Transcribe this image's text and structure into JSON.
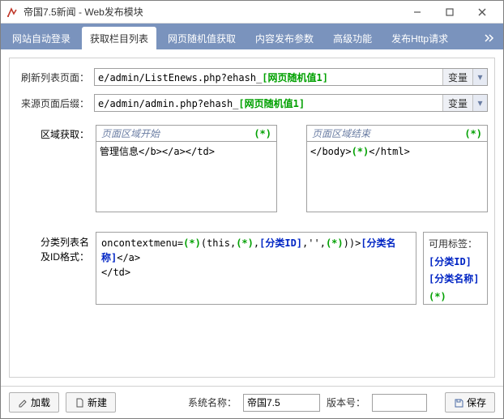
{
  "window": {
    "title": "帝国7.5新闻 - Web发布模块"
  },
  "tabs": {
    "items": [
      {
        "label": "网站自动登录"
      },
      {
        "label": "获取栏目列表"
      },
      {
        "label": "网页随机值获取"
      },
      {
        "label": "内容发布参数"
      },
      {
        "label": "高级功能"
      },
      {
        "label": "发布Http请求"
      }
    ]
  },
  "refresh_list": {
    "label": "刷新列表页面：",
    "url_prefix": "e/admin/ListEnews.php?ehash_",
    "url_tag": "[网页随机值1]",
    "badge": "变量"
  },
  "source_suffix": {
    "label": "来源页面后缀：",
    "url_prefix": "e/admin/admin.php?ehash_",
    "url_tag": "[网页随机值1]",
    "badge": "变量"
  },
  "region": {
    "label": "区域获取：",
    "start_label": "页面区域开始",
    "start_star": "(*)",
    "start_body": "管理信息</b></a></td>",
    "end_label": "页面区域结束",
    "end_star": "(*)",
    "end_body_a": "</body>",
    "end_body_star": "(*)",
    "end_body_b": "</html>"
  },
  "cls": {
    "label_a": "分类列表名",
    "label_b": "及ID格式：",
    "body_a": "oncontextmenu=",
    "body_b": "(this,",
    "body_d": "[分类ID]",
    "body_e": ",'',",
    "body_f": ")>",
    "body_g": "[分类名称]",
    "body_h": "</a>",
    "body_i": "</td>",
    "star": "(*)"
  },
  "tags": {
    "header": "可用标签：",
    "tag1": "[分类ID]",
    "tag2": "[分类名称]",
    "tag3": "(*)"
  },
  "footer": {
    "load": "加载",
    "newbtn": "新建",
    "sysname_label": "系统名称：",
    "sysname_value": "帝国7.5",
    "ver_label": "版本号：",
    "ver_value": "",
    "save": "保存"
  }
}
